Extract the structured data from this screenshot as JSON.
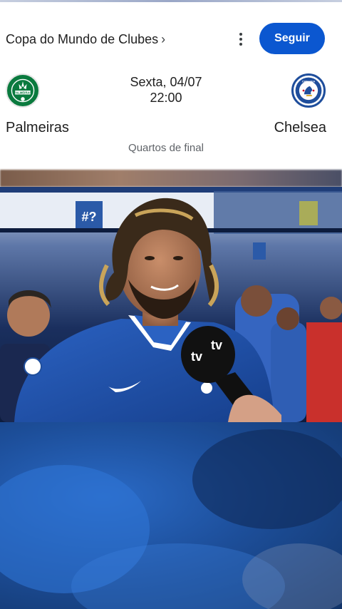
{
  "header": {
    "league": "Copa do Mundo de Clubes",
    "league_chevron": "›",
    "more_icon": "more-vert-icon",
    "follow_label": "Seguir"
  },
  "match": {
    "home": {
      "name": "Palmeiras",
      "logo_letters": "PALMEIRAS"
    },
    "away": {
      "name": "Chelsea",
      "logo_letters": "CHELSEA"
    },
    "day_date": "Sexta, 04/07",
    "time": "22:00",
    "stage": "Quartos de final"
  },
  "video": {
    "mic_brand": "tv",
    "description_icon": "interview-video"
  },
  "colors": {
    "accent": "#0b57d0",
    "jersey": "#1d4f9b",
    "home_green": "#0a7a3e",
    "away_blue": "#1f4e9c"
  }
}
